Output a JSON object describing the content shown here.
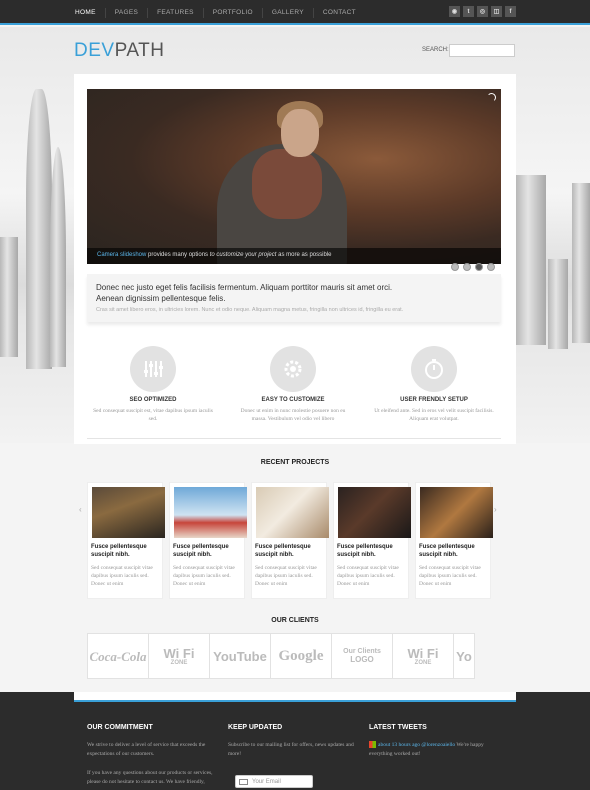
{
  "nav": {
    "items": [
      "HOME",
      "PAGES",
      "FEATURES",
      "PORTFOLIO",
      "GALLERY",
      "CONTACT"
    ],
    "active": "HOME",
    "social_icons": [
      "rss-icon",
      "twitter-icon",
      "dribbble-icon",
      "delicious-icon",
      "facebook-icon"
    ]
  },
  "header": {
    "logo_part1": "DEV",
    "logo_part2": "PATH",
    "logo_color": "#3aa0d8",
    "search_label": "SEARCH:",
    "search_value": ""
  },
  "slider": {
    "caption_link": "Camera slideshow",
    "caption_text1": " provides many options ",
    "caption_italic": "to customize your project",
    "caption_text2": " as more as possible",
    "dots": 4,
    "active_dot": 3
  },
  "intro": {
    "line1": "Donec nec justo eget felis facilisis fermentum. Aliquam porttitor mauris sit amet orci.",
    "line2": "Aenean dignissim pellentesque felis.",
    "line3": "Cras sit amet libero eros, in ultricies lorem. Nunc et odio neque. Aliquam magna metus, fringilla non ultrices id, fringilla eu erat."
  },
  "features": [
    {
      "icon": "equalizer-icon",
      "title": "SEO OPTIMIZED",
      "text": "Sed consequat suscipit est, vitae dapibus ipsum iaculis sed."
    },
    {
      "icon": "gear-icon",
      "title": "EASY TO CUSTOMIZE",
      "text": "Donec ut enim in nunc molestie posuere non eu massa. Vestibulum vel odio vel libero"
    },
    {
      "icon": "stopwatch-icon",
      "title": "USER FRENDLY SETUP",
      "text": "Ut eleifend ante. Sed in eros vel velit suscipit facilisis. Aliquam erat volutpat."
    }
  ],
  "recent_projects": {
    "title": "RECENT PROJECTS",
    "items": [
      {
        "title": "Fusce pellentesque suscipit nibh.",
        "text": "Sed consequat suscipit vitae dapibus ipsum iaculis sed. Donec ut enim"
      },
      {
        "title": "Fusce pellentesque suscipit nibh.",
        "text": "Sed consequat suscipit vitae dapibus ipsum iaculis sed. Donec ut enim"
      },
      {
        "title": "Fusce pellentesque suscipit nibh.",
        "text": "Sed consequat suscipit vitae dapibus ipsum iaculis sed. Donec ut enim"
      },
      {
        "title": "Fusce pellentesque suscipit nibh.",
        "text": "Sed consequat suscipit vitae dapibus ipsum iaculis sed. Donec ut enim"
      },
      {
        "title": "Fusce pellentesque suscipit nibh.",
        "text": "Sed consequat suscipit vitae dapibus ipsum iaculis sed. Donec ut enim"
      }
    ]
  },
  "clients": {
    "title": "OUR CLIENTS",
    "logos": [
      {
        "big": "Coca-Cola",
        "small": ""
      },
      {
        "big": "Wi Fi",
        "small": "ZONE"
      },
      {
        "big": "YouTube",
        "small": ""
      },
      {
        "big": "Google",
        "small": ""
      },
      {
        "big": "Our Clients",
        "small": "LOGO"
      },
      {
        "big": "Wi Fi",
        "small": "ZONE"
      },
      {
        "big": "Yo",
        "small": ""
      }
    ]
  },
  "footer": {
    "commitment": {
      "title": "OUR COMMITMENT",
      "p1": "We strive to deliver a level of service that exceeds the expectations of our customers.",
      "p2": "If you have any questions about our products or services, please do not hesitate to contact us. We have friendly,"
    },
    "updates": {
      "title": "KEEP UPDATED",
      "text": "Subscribe to our mailing list for offers, news updates and more!",
      "email_placeholder": "Your Email"
    },
    "tweets": {
      "title": "LATEST TWEETS",
      "link": "about 13 hours ago @lorenzoaiello",
      "text": " We're happy everything worked out!"
    }
  }
}
